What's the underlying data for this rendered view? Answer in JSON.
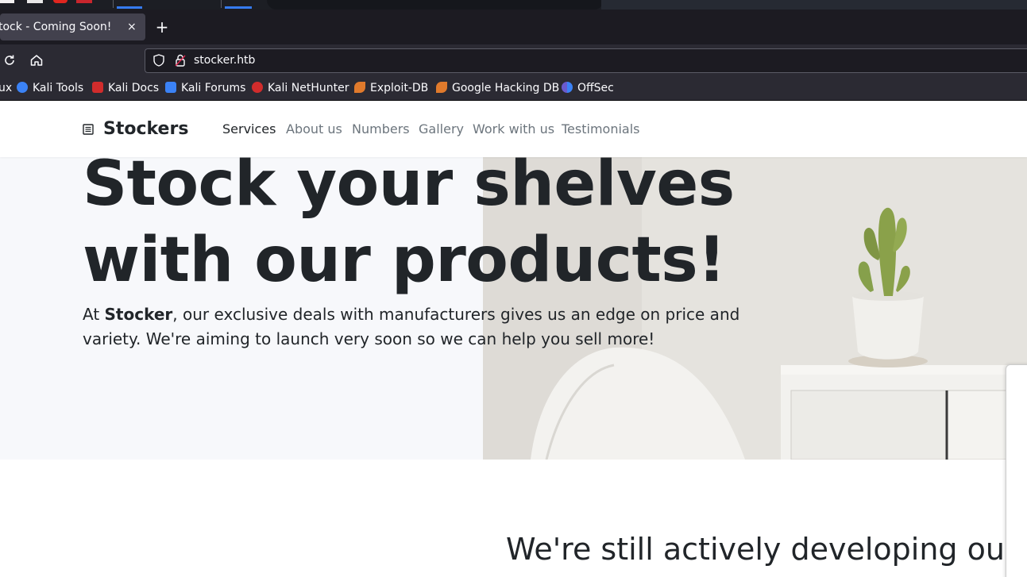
{
  "browser": {
    "tab_title": "tock - Coming Soon!",
    "tab_close": "×",
    "new_tab": "+",
    "url": "stocker.htb",
    "bookmarks": [
      {
        "label": "ux",
        "color": "#2b2a33"
      },
      {
        "label": "Kali Tools",
        "color": "#3b82f6"
      },
      {
        "label": "Kali Docs",
        "color": "#d12c2c"
      },
      {
        "label": "Kali Forums",
        "color": "#3b82f6"
      },
      {
        "label": "Kali NetHunter",
        "color": "#d12c2c"
      },
      {
        "label": "Exploit-DB",
        "color": "#e07a2c"
      },
      {
        "label": "Google Hacking DB",
        "color": "#e07a2c"
      },
      {
        "label": "OffSec",
        "color": "#6a5acd"
      }
    ]
  },
  "site": {
    "brand": "Stockers",
    "nav": [
      "Services",
      "About us",
      "Numbers",
      "Gallery",
      "Work with us",
      "Testimonials"
    ],
    "hero": {
      "title_line1": "Stock your shelves",
      "title_line2": "with our products!",
      "text_prefix": "At ",
      "text_brand": "Stocker",
      "text_rest": ", our exclusive deals with manufacturers gives us an edge on price and variety. We're aiming to launch very soon so we can help you sell more!"
    },
    "section_heading": "We're still actively developing our"
  },
  "colors": {
    "accent": "#367bf0",
    "text": "#212529",
    "muted": "#6c757d",
    "hero_bg": "#f7f8fb"
  }
}
